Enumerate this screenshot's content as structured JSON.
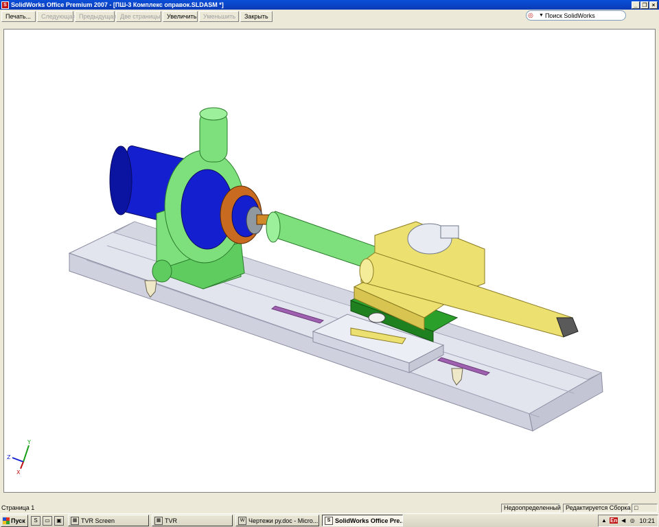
{
  "window": {
    "title": "SolidWorks Office Premium 2007 - [ПШ-3 Комплекс оправок.SLDASM *]",
    "app_icon": "solidworks-icon",
    "controls": [
      "minimize-icon",
      "restore-icon",
      "close-icon"
    ]
  },
  "toolbar": {
    "print": "Печать...",
    "next": "Следующая",
    "previous": "Предыдущая",
    "two_pages": "Две страницы",
    "zoom_in": "Увеличить",
    "zoom_out": "Уменьшить",
    "close": "Закрыть"
  },
  "search": {
    "placeholder": "Поиск SolidWorks",
    "icon": "search-icon"
  },
  "triad": {
    "x": "X",
    "y": "Y",
    "z": "Z"
  },
  "status": {
    "page": "Страница 1",
    "definition": "Недоопределенный",
    "mode": "Редактируется Сборка"
  },
  "taskbar": {
    "start": "Пуск",
    "tasks": [
      {
        "label": "TVR Screen",
        "icon": "tvr-icon"
      },
      {
        "label": "TVR",
        "icon": "tvr-icon"
      },
      {
        "label": "Чертежи ру.doc - Micro...",
        "icon": "word-icon"
      },
      {
        "label": "SolidWorks Office Pre...",
        "icon": "solidworks-icon"
      }
    ],
    "language": "En",
    "clock": "10:21"
  },
  "colors": {
    "titlebar": "#0b46c8",
    "rail": "#e2e4ee",
    "chuck_green": "#7de07d",
    "motor_blue": "#1420d0",
    "bracket_yellow": "#ece070",
    "slot_purple": "#a060b0"
  }
}
